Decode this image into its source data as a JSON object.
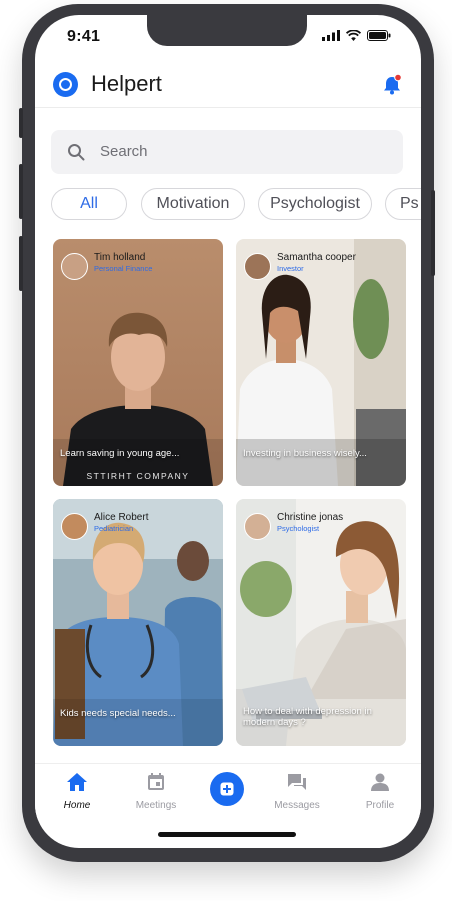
{
  "status_bar": {
    "time": "9:41"
  },
  "header": {
    "title": "Helpert"
  },
  "search": {
    "placeholder": "Search"
  },
  "filters": [
    "All",
    "Motivation",
    "Psychologist",
    "Ps"
  ],
  "cards": [
    {
      "name": "Tim holland",
      "tag": "Personal Finance",
      "caption": "Learn saving in young age...",
      "shirt_text": "STTIRHT COMPANY"
    },
    {
      "name": "Samantha cooper",
      "tag": "Investor",
      "caption": "Investing in business wisely..."
    },
    {
      "name": "Alice Robert",
      "tag": "Pediatrician",
      "caption": "Kids needs special needs..."
    },
    {
      "name": "Christine jonas",
      "tag": "Psychologist",
      "caption": "How to deal with depression in modern days ?"
    }
  ],
  "tabbar": {
    "items": [
      {
        "label": "Home",
        "icon": "home-icon"
      },
      {
        "label": "Meetings",
        "icon": "calendar-icon"
      },
      {
        "label": "",
        "icon": "add-icon"
      },
      {
        "label": "Messages",
        "icon": "chat-icon"
      },
      {
        "label": "Profile",
        "icon": "user-icon"
      }
    ]
  },
  "colors": {
    "accent": "#1a6bf0",
    "notification_dot": "#e53935",
    "frame": "#3a3a3f"
  }
}
